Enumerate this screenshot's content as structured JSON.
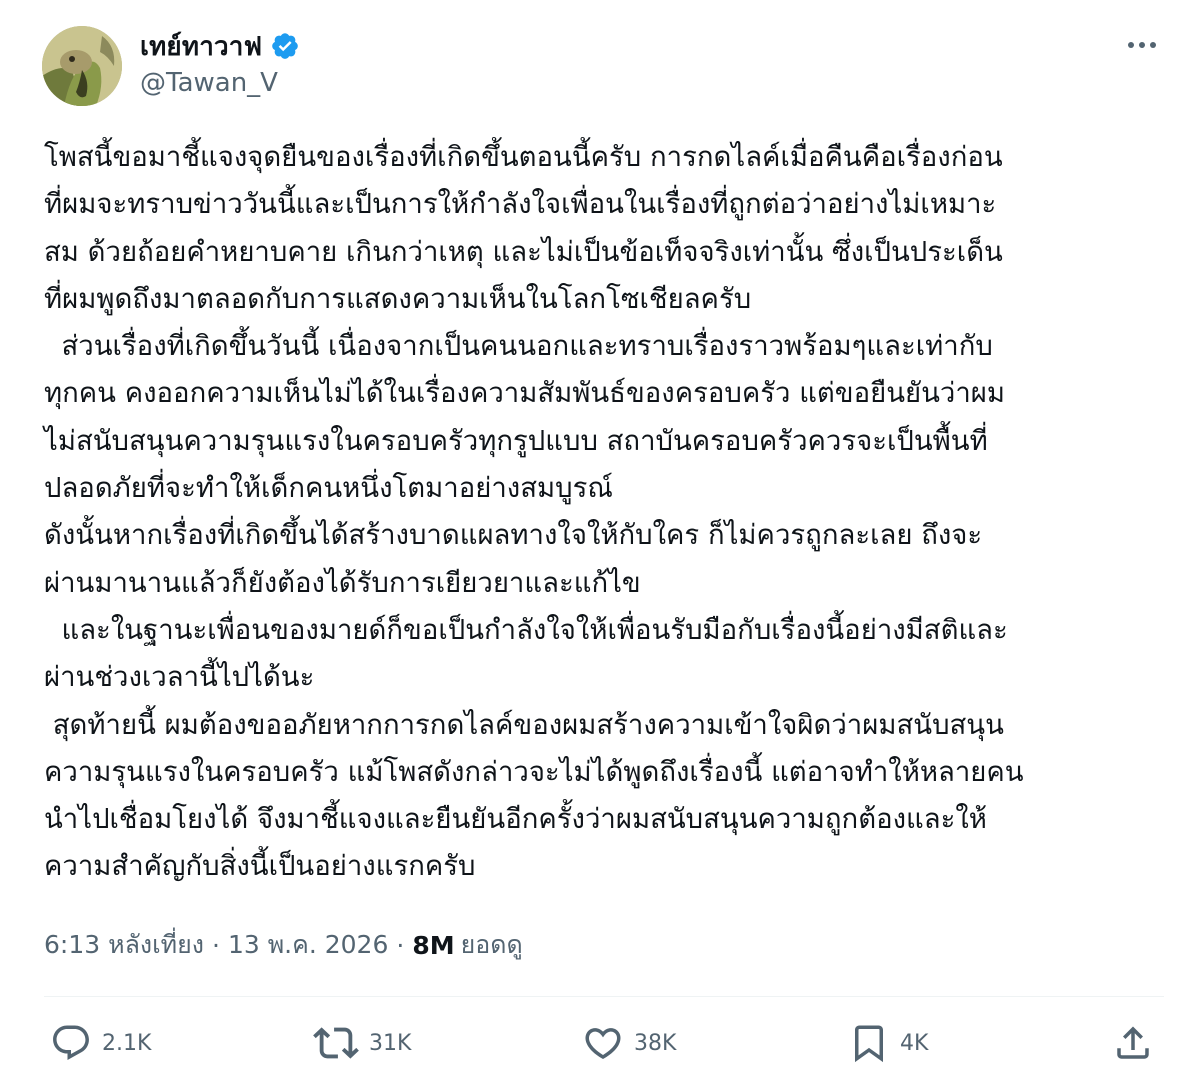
{
  "author": {
    "display_name": "เทย์ทาวาฟ",
    "handle": "@Tawan_V",
    "verified": true,
    "verified_color": "#1d9bf0",
    "avatar_icon": "avatar-illustration"
  },
  "tweet": {
    "lines": [
      "โพสนี้ขอมาชี้แจงจุดยืนของเรื่องที่เกิดขึ้นตอนนี้ครับ การกดไลค์เมื่อคืนคือเรื่องก่อน",
      "ที่ผมจะทราบข่าววันนี้และเป็นการให้กำลังใจเพื่อนในเรื่องที่ถูกต่อว่าอย่างไม่เหมาะ",
      "สม ด้วยถ้อยคำหยาบคาย เกินกว่าเหตุ และไม่เป็นข้อเท็จจริงเท่านั้น ซึ่งเป็นประเด็น",
      "ที่ผมพูดถึงมาตลอดกับการแสดงความเห็นในโลกโซเชียลครับ",
      "  ส่วนเรื่องที่เกิดขึ้นวันนี้ เนื่องจากเป็นคนนอกและทราบเรื่องราวพร้อมๆและเท่ากับ",
      "ทุกคน คงออกความเห็นไม่ได้ในเรื่องความสัมพันธ์ของครอบครัว แต่ขอยืนยันว่าผม",
      "ไม่สนับสนุนความรุนแรงในครอบครัวทุกรูปแบบ สถาบันครอบครัวควรจะเป็นพื้นที่",
      "ปลอดภัยที่จะทำให้เด็กคนหนึ่งโตมาอย่างสมบูรณ์",
      "ดังนั้นหากเรื่องที่เกิดขึ้นได้สร้างบาดแผลทางใจให้กับใคร ก็ไม่ควรถูกละเลย ถึงจะ",
      "ผ่านมานานแล้วก็ยังต้องได้รับการเยียวยาและแก้ไข",
      "  และในฐานะเพื่อนของมายด์ก็ขอเป็นกำลังใจให้เพื่อนรับมือกับเรื่องนี้อย่างมีสติและ",
      "ผ่านช่วงเวลานี้ไปได้นะ",
      " สุดท้ายนี้ ผมต้องขออภัยหากการกดไลค์ของผมสร้างความเข้าใจผิดว่าผมสนับสนุน",
      "ความรุนแรงในครอบครัว แม้โพสดังกล่าวจะไม่ได้พูดถึงเรื่องนี้ แต่อาจทำให้หลายคน",
      "นำไปเชื่อมโยงได้ จึงมาชี้แจงและยืนยันอีกครั้งว่าผมสนับสนุนความถูกต้องและให้",
      "ความสำคัญกับสิ่งนี้เป็นอย่างแรกครับ"
    ]
  },
  "meta": {
    "time": "6:13 หลังเที่ยง",
    "separator": "·",
    "date": "13 พ.ค. 2026",
    "views_count": "8M",
    "views_label": "ยอดดู"
  },
  "actions": {
    "reply": {
      "icon": "reply-icon",
      "count": "2.1K"
    },
    "retweet": {
      "icon": "retweet-icon",
      "count": "31K"
    },
    "like": {
      "icon": "heart-icon",
      "count": "38K"
    },
    "bookmark": {
      "icon": "bookmark-icon",
      "count": "4K"
    },
    "share": {
      "icon": "share-icon"
    }
  },
  "colors": {
    "text_primary": "#0f1419",
    "text_secondary": "#536471",
    "divider": "#eff3f4",
    "verified": "#1d9bf0"
  }
}
